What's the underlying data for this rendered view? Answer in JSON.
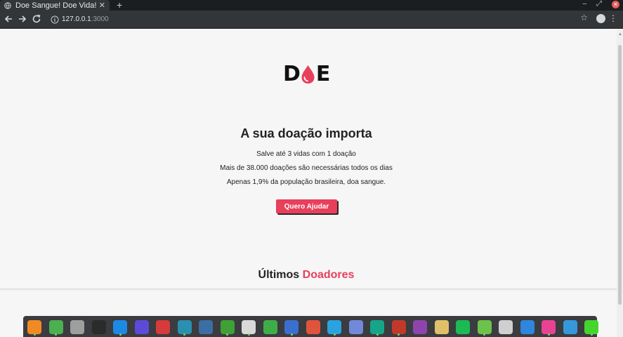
{
  "browser": {
    "tab_title": "Doe Sangue! Doe Vida!",
    "tab_close": "✕",
    "new_tab": "+",
    "url_host": "127.0.0.1",
    "url_port": ":3000",
    "star": "☆",
    "menu": "⋮",
    "minimize": "–",
    "maximize": "⤢",
    "close": "✕"
  },
  "logo": {
    "left_letter": "D",
    "right_letter": "E",
    "drop_color": "#e83f5b"
  },
  "hero": {
    "title": "A sua doação importa",
    "lines": [
      "Salve até 3 vidas com 1 doação",
      "Mais de 38.000 doações são necessárias todos os dias",
      "Apenas 1,9% da população brasileira, doa sangue."
    ],
    "cta_label": "Quero Ajudar"
  },
  "donors": {
    "title_prefix": "Últimos",
    "title_accent": "Doadores",
    "accent_color": "#e83f5b"
  },
  "dock": {
    "apps": [
      {
        "icon": "firefox-icon",
        "color": "#f08a24"
      },
      {
        "icon": "chrome-icon",
        "color": "#4caf50"
      },
      {
        "icon": "files-icon",
        "color": "#9e9e9e"
      },
      {
        "icon": "terminal-icon",
        "color": "#2b2b2b"
      },
      {
        "icon": "vscode-icon",
        "color": "#1e88e5"
      },
      {
        "icon": "app-purple-icon",
        "color": "#5c4bd8"
      },
      {
        "icon": "app-red-icon",
        "color": "#d63a3a"
      },
      {
        "icon": "app-teal-icon",
        "color": "#2b8fb0"
      },
      {
        "icon": "postgres-icon",
        "color": "#3b6ea5"
      },
      {
        "icon": "mongodb-icon",
        "color": "#3fa037"
      },
      {
        "icon": "app-blocked-icon",
        "color": "#d9d9d9"
      },
      {
        "icon": "spreadsheet-icon",
        "color": "#3fae49"
      },
      {
        "icon": "document-icon",
        "color": "#3b6fcf"
      },
      {
        "icon": "presentation-icon",
        "color": "#e0533d"
      },
      {
        "icon": "telegram-icon",
        "color": "#2aa3df"
      },
      {
        "icon": "discord-icon",
        "color": "#7289da"
      },
      {
        "icon": "app-green-icon",
        "color": "#17a589"
      },
      {
        "icon": "recorder-icon",
        "color": "#c0392b"
      },
      {
        "icon": "video-icon",
        "color": "#8e44ad"
      },
      {
        "icon": "speaker-icon",
        "color": "#e0c068"
      },
      {
        "icon": "spotify-icon",
        "color": "#1db954"
      },
      {
        "icon": "node-icon",
        "color": "#6cc24a"
      },
      {
        "icon": "usb-icon",
        "color": "#cfcfcf"
      },
      {
        "icon": "monitor-icon",
        "color": "#2e86de"
      },
      {
        "icon": "photos-icon",
        "color": "#e84393"
      },
      {
        "icon": "steam-icon",
        "color": "#3498db"
      },
      {
        "icon": "razer-icon",
        "color": "#44d62c"
      }
    ]
  }
}
